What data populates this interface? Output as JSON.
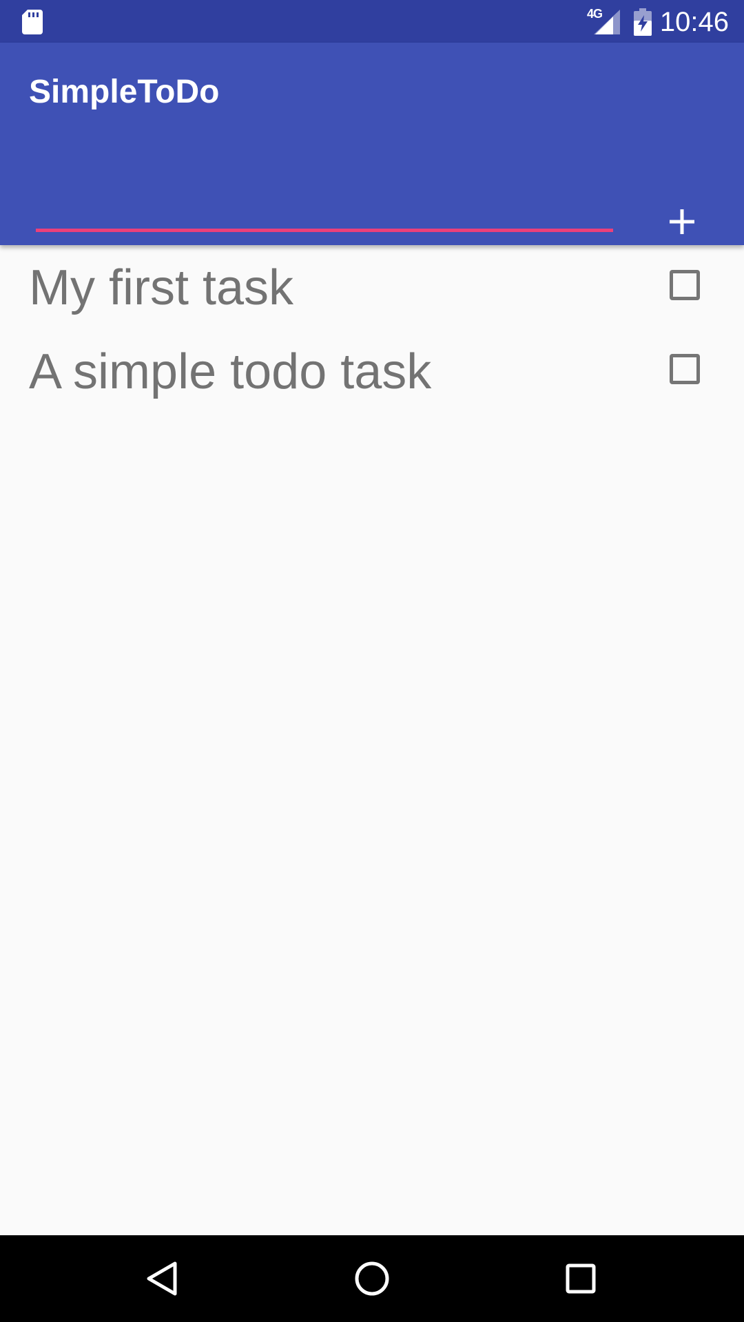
{
  "status_bar": {
    "time": "10:46",
    "network": "4G",
    "icons": [
      "sd-card-icon",
      "signal-icon",
      "battery-charging-icon"
    ]
  },
  "app_bar": {
    "title": "SimpleToDo",
    "input": {
      "value": "",
      "placeholder": ""
    },
    "add_button_icon": "plus-icon"
  },
  "tasks": [
    {
      "label": "My first task",
      "checked": false
    },
    {
      "label": "A simple todo task",
      "checked": false
    }
  ],
  "nav_bar": {
    "icons": [
      "back-icon",
      "home-icon",
      "recents-icon"
    ]
  },
  "colors": {
    "status_bar": "#303f9f",
    "primary": "#3f51b5",
    "accent": "#ec407a",
    "background": "#fafafa",
    "task_text": "#737373"
  }
}
